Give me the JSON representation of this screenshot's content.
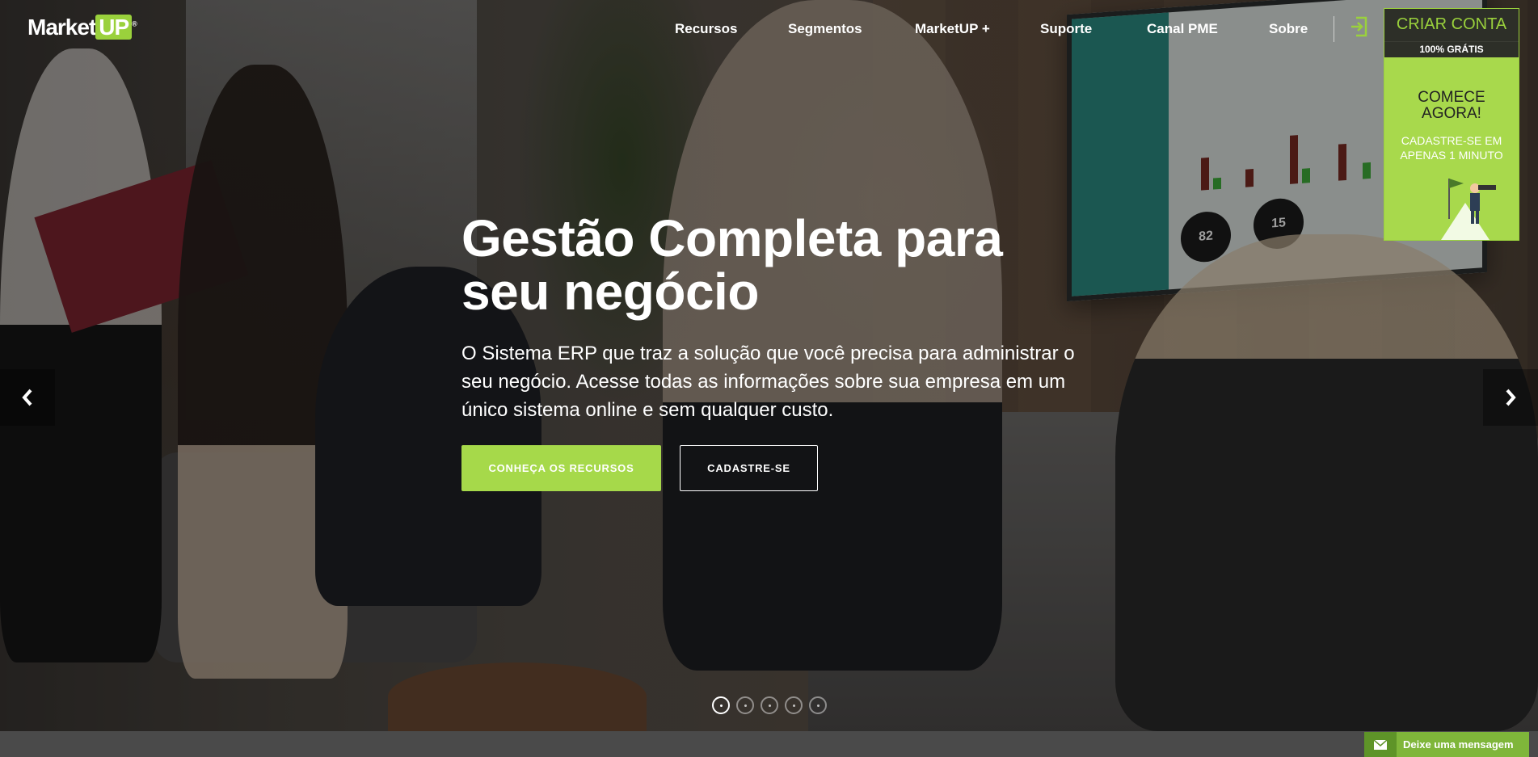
{
  "brand": {
    "name_market": "Market",
    "name_up": "UP",
    "mark": "®"
  },
  "nav": {
    "items": [
      {
        "label": "Recursos"
      },
      {
        "label": "Segmentos"
      },
      {
        "label": "MarketUP +"
      },
      {
        "label": "Suporte"
      },
      {
        "label": "Canal PME"
      },
      {
        "label": "Sobre"
      }
    ],
    "login_icon": "sign-in-icon"
  },
  "promo": {
    "title": "CRIAR CONTA",
    "subtitle": "100% GRÁTIS",
    "cta": "COMECE AGORA!",
    "line": "CADASTRE-SE EM APENAS 1 MINUTO"
  },
  "hero": {
    "headline": "Gestão Completa para seu negócio",
    "subtext": "O Sistema ERP que traz a solução que você precisa para administrar o seu negócio. Acesse todas as informações sobre sua empresa em um único sistema online e sem qualquer custo.",
    "primary_button": "CONHEÇA OS RECURSOS",
    "secondary_button": "CADASTRE-SE",
    "screen_stat_1": "82",
    "screen_stat_2": "15"
  },
  "carousel": {
    "slide_count": 5,
    "active_index": 0,
    "prev_icon": "chevron-left-icon",
    "next_icon": "chevron-right-icon"
  },
  "chat": {
    "label": "Deixe uma mensagem",
    "icon": "envelope-icon"
  },
  "colors": {
    "accent": "#a6d94a",
    "promo_dark": "#2d2f28",
    "chat_green": "#7fb63a"
  }
}
